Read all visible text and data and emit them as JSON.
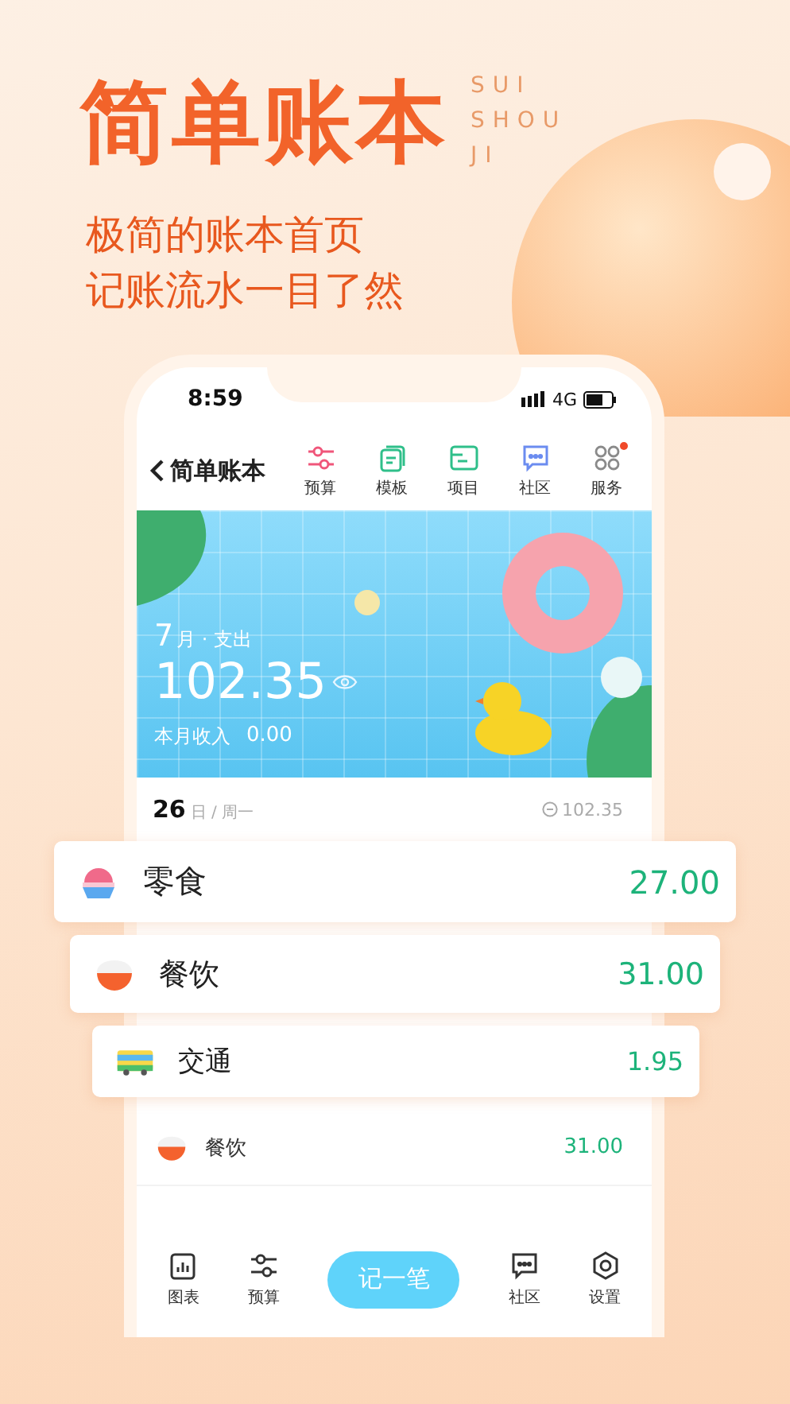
{
  "headline": "简单账本",
  "brand_letters": [
    "SUI",
    "SHOU",
    "JI"
  ],
  "subtitle_lines": [
    "极简的账本首页",
    "记账流水一目了然"
  ],
  "phone": {
    "status_bar": {
      "time": "8:59",
      "network": "4G"
    },
    "nav": {
      "back_title": "简单账本",
      "items": [
        {
          "label": "预算",
          "kind": "budget",
          "badge": false
        },
        {
          "label": "模板",
          "kind": "template",
          "badge": false
        },
        {
          "label": "项目",
          "kind": "project",
          "badge": false
        },
        {
          "label": "社区",
          "kind": "community",
          "badge": false
        },
        {
          "label": "服务",
          "kind": "services",
          "badge": true
        }
      ]
    },
    "summary": {
      "month": "7",
      "month_unit": "月 · 支出",
      "amount": "102.35",
      "income_label": "本月收入",
      "income": "0.00"
    },
    "day": {
      "day": "26",
      "weekday": "日 / 周一",
      "total": "102.35"
    },
    "entries": [
      {
        "category": "零食",
        "amount": "27.00",
        "kind": "snack",
        "floating": true
      },
      {
        "category": "餐饮",
        "amount": "31.00",
        "kind": "rice",
        "floating": true
      },
      {
        "category": "交通",
        "amount": "1.95",
        "kind": "bus",
        "floating": true
      },
      {
        "category": "餐饮",
        "amount": "31.00",
        "kind": "rice",
        "floating": false
      }
    ],
    "tab_bar": {
      "left": [
        {
          "label": "图表",
          "kind": "chart"
        },
        {
          "label": "预算",
          "kind": "budget"
        }
      ],
      "action": "记一笔",
      "right": [
        {
          "label": "社区",
          "kind": "community"
        },
        {
          "label": "设置",
          "kind": "settings"
        }
      ]
    }
  }
}
